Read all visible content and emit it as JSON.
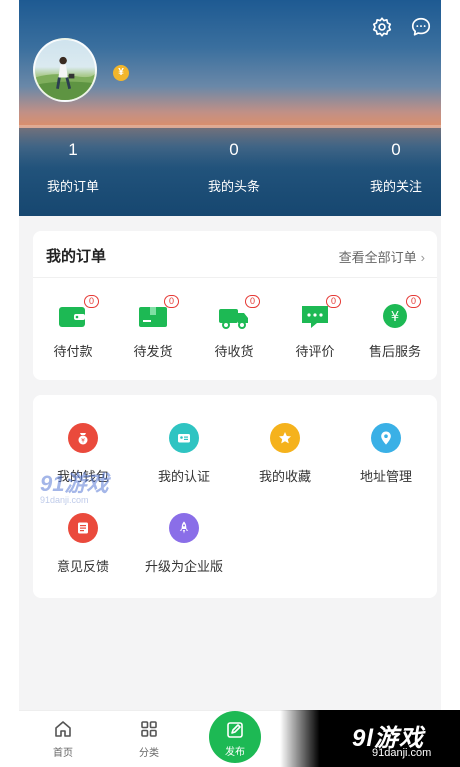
{
  "profile": {
    "vip_badge": "¥",
    "stats": [
      {
        "value": "1",
        "label": "我的订单"
      },
      {
        "value": "0",
        "label": "我的头条"
      },
      {
        "value": "0",
        "label": "我的关注"
      }
    ]
  },
  "header_icons": [
    "settings-icon",
    "message-icon"
  ],
  "orders": {
    "title": "我的订单",
    "view_all": "查看全部订单",
    "items": [
      {
        "label": "待付款",
        "badge": "0",
        "icon": "wallet-icon"
      },
      {
        "label": "待发货",
        "badge": "0",
        "icon": "package-icon"
      },
      {
        "label": "待收货",
        "badge": "0",
        "icon": "truck-icon"
      },
      {
        "label": "待评价",
        "badge": "0",
        "icon": "comment-icon"
      },
      {
        "label": "售后服务",
        "badge": "0",
        "icon": "after-sales-icon"
      }
    ]
  },
  "services": {
    "items": [
      {
        "label": "我的钱包",
        "icon": "wallet-bag-icon",
        "color": "#ea4a3c"
      },
      {
        "label": "我的认证",
        "icon": "id-card-icon",
        "color": "#2fc4c2"
      },
      {
        "label": "我的收藏",
        "icon": "star-icon",
        "color": "#f5b21c"
      },
      {
        "label": "地址管理",
        "icon": "location-icon",
        "color": "#3ab0e6"
      },
      {
        "label": "意见反馈",
        "icon": "feedback-icon",
        "color": "#ea4a3c"
      },
      {
        "label": "升级为企业版",
        "icon": "rocket-icon",
        "color": "#8a6ee8"
      }
    ]
  },
  "bottom_nav": {
    "items": [
      {
        "label": "首页",
        "icon": "home-icon"
      },
      {
        "label": "分类",
        "icon": "grid-icon"
      },
      {
        "label": "发布",
        "icon": "edit-icon"
      }
    ]
  },
  "watermarks": {
    "logo_small_text": "91游戏",
    "logo_small_url": "91danji.com",
    "logo_big_text": "9l游戏",
    "logo_big_url": "91danji.com"
  },
  "colors": {
    "accent": "#1db954",
    "badge": "#e53935"
  }
}
